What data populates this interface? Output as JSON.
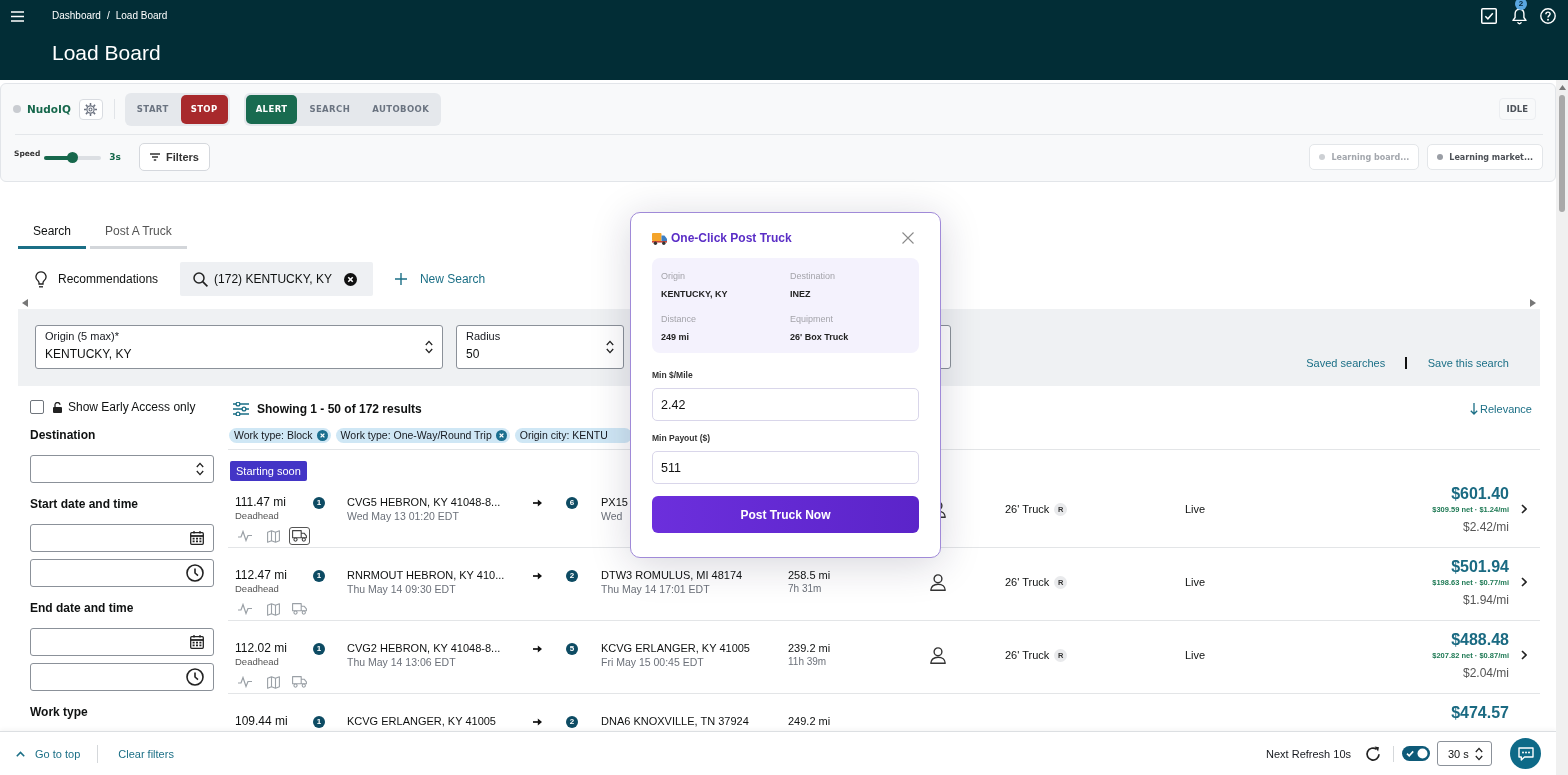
{
  "header": {
    "breadcrumb": [
      "Dashboard",
      "Load Board"
    ],
    "separator": "/",
    "title": "Load Board",
    "notification_count": "2"
  },
  "toolbar": {
    "brand": "NudoIQ",
    "run_buttons": [
      {
        "label": "START",
        "selected": false
      },
      {
        "label": "STOP",
        "selected": true
      }
    ],
    "mode_buttons": [
      {
        "label": "ALERT",
        "selected": true
      },
      {
        "label": "SEARCH",
        "selected": false
      },
      {
        "label": "AUTOBOOK",
        "selected": false
      }
    ],
    "status": "IDLE",
    "speed": {
      "label": "Speed",
      "level": 0.5,
      "reading": "3s"
    },
    "filters_button": "Filters",
    "learning_chips": [
      {
        "label": "Learning board...",
        "color": "#cdd0d4",
        "dimmed": true
      },
      {
        "label": "Learning market...",
        "color": "#9a9ea5",
        "dimmed": false
      }
    ]
  },
  "tabs": [
    {
      "label": "Search",
      "selected": true
    },
    {
      "label": "Post A Truck",
      "selected": false
    }
  ],
  "search_bar": {
    "recommendations": "Recommendations",
    "active_search": "(172) KENTUCKY, KY",
    "new_search": "New Search"
  },
  "search_form": {
    "fields": [
      {
        "kind": "location",
        "label": "Origin (5 max)*",
        "value": "KENTUCKY, KY"
      },
      {
        "kind": "radius",
        "label": "Radius",
        "value": "50"
      }
    ],
    "saved_searches": "Saved searches",
    "save_search": "Save this search"
  },
  "sidebar": {
    "early_access": {
      "label": "Show Early Access only",
      "checked": false
    },
    "sections": [
      {
        "kind": "select",
        "label": "Destination"
      },
      {
        "kind": "datetime",
        "label": "Start date and time"
      },
      {
        "kind": "datetime",
        "label": "End date and time"
      },
      {
        "kind": "heading",
        "label": "Work type"
      }
    ]
  },
  "results": {
    "summary": "Showing 1 - 50 of 172 results",
    "sort": "Relevance",
    "chips": [
      {
        "kind": "removable",
        "label": "Work type: Block"
      },
      {
        "kind": "removable",
        "label": "Work type: One-Way/Round Trip"
      },
      {
        "kind": "plain",
        "label": "Origin city: KENTU"
      }
    ],
    "rows": [
      {
        "kind": "full",
        "badge": "Starting soon",
        "deadhead": "111.47 mi",
        "deadhead_label": "Deadhead",
        "truck_active": true,
        "origin_stops": "1",
        "origin": "CVG5 HEBRON, KY 41048-8...",
        "pickup_time": "Wed May 13 01:20 EDT",
        "destination_stops": "6",
        "destination": "PX15",
        "dropoff_time": "Wed",
        "equipment": "26' Truck",
        "equipment_code": "R",
        "status": "Live",
        "price": "$601.40",
        "net": "$309.59 net · $1.24/mi",
        "rate": "$2.42/mi"
      },
      {
        "kind": "full",
        "deadhead": "112.47 mi",
        "deadhead_label": "Deadhead",
        "truck_active": false,
        "origin_stops": "1",
        "origin": "RNRMOUT HEBRON, KY 410...",
        "pickup_time": "Thu May 14 09:30 EDT",
        "destination_stops": "2",
        "destination": "DTW3 ROMULUS, MI 48174",
        "dropoff_time": "Thu May 14 17:01 EDT",
        "distance": "258.5 mi",
        "duration": "7h 31m",
        "equipment": "26' Truck",
        "equipment_code": "R",
        "status": "Live",
        "price": "$501.94",
        "net": "$198.63 net · $0.77/mi",
        "rate": "$1.94/mi"
      },
      {
        "kind": "full",
        "deadhead": "112.02 mi",
        "deadhead_label": "Deadhead",
        "truck_active": false,
        "origin_stops": "1",
        "origin": "CVG2 HEBRON, KY 41048-8...",
        "pickup_time": "Thu May 14 13:06 EDT",
        "destination_stops": "5",
        "destination": "KCVG ERLANGER, KY 41005",
        "dropoff_time": "Fri May 15 00:45 EDT",
        "distance": "239.2 mi",
        "duration": "11h 39m",
        "equipment": "26' Truck",
        "equipment_code": "R",
        "status": "Live",
        "price": "$488.48",
        "net": "$207.82 net · $0.87/mi",
        "rate": "$2.04/mi"
      },
      {
        "kind": "cut",
        "deadhead": "109.44 mi",
        "origin_stops": "1",
        "origin": "KCVG ERLANGER, KY 41005",
        "destination_stops": "2",
        "destination": "DNA6 KNOXVILLE, TN 37924",
        "distance": "249.2 mi",
        "price": "$474.57"
      }
    ]
  },
  "post_truck_dialog": {
    "title": "One-Click Post Truck",
    "details": [
      {
        "label": "Origin",
        "value": "KENTUCKY, KY"
      },
      {
        "label": "Destination",
        "value": "INEZ"
      },
      {
        "label": "Distance",
        "value": "249 mi"
      },
      {
        "label": "Equipment",
        "value": "26' Box Truck"
      }
    ],
    "fields": [
      {
        "label": "Min $/Mile",
        "value": "2.42"
      },
      {
        "label": "Min Payout ($)",
        "value": "511"
      }
    ],
    "submit": "Post Truck Now"
  },
  "footer": {
    "go_to_top": "Go to top",
    "clear_filters": "Clear filters",
    "next_refresh": "Next Refresh 10s",
    "auto_refresh": {
      "on": true
    },
    "interval": "30 s"
  }
}
